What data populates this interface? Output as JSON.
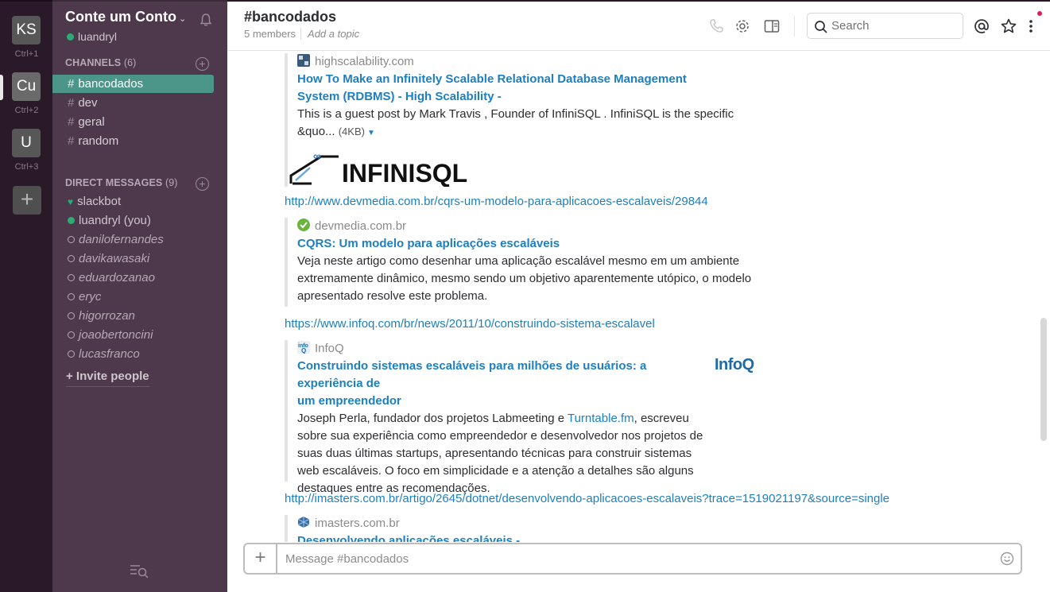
{
  "workspaces": [
    {
      "initials": "KS",
      "shortcut": "Ctrl+1"
    },
    {
      "initials": "Cu",
      "shortcut": "Ctrl+2"
    },
    {
      "initials": "U",
      "shortcut": "Ctrl+3"
    }
  ],
  "add_workspace": "+",
  "team": {
    "name": "Conte um Conto",
    "user": "luandryl"
  },
  "channels": {
    "label": "CHANNELS",
    "count": "(6)",
    "items": [
      "bancodados",
      "dev",
      "geral",
      "random"
    ]
  },
  "direct_messages": {
    "label": "DIRECT MESSAGES",
    "count": "(9)",
    "items": [
      "slackbot",
      "luandryl (you)",
      "danilofernandes",
      "davikawasaki",
      "eduardozanao",
      "eryc",
      "higorrozan",
      "joaobertoncini",
      "lucasfranco"
    ]
  },
  "invite_label": "+ Invite people",
  "header": {
    "title": "#bancodados",
    "members": "5 members",
    "topic": "Add a topic",
    "search_placeholder": "Search"
  },
  "messages": {
    "att1": {
      "source": "highscalability.com",
      "title_line1": "How To Make an Infinitely Scalable Relational Database Management",
      "title_line2": "System (RDBMS) - High Scalability -",
      "text_line1": "This is a guest post by Mark Travis , Founder of InfiniSQL . InfiniSQL is the specific",
      "text_line2": "&quo...",
      "size": "(4KB)",
      "logo_text": "INFINISQL"
    },
    "link2": "http://www.devmedia.com.br/cqrs-um-modelo-para-aplicacoes-escalaveis/29844",
    "att2": {
      "source": "devmedia.com.br",
      "title": "CQRS: Um modelo para aplicações escaláveis",
      "text_line1": "Veja neste artigo como desenhar uma aplicação escalável mesmo em um ambiente",
      "text_line2": "extremamente dinâmico, mesmo sendo um objetivo aparentemente utópico, o modelo",
      "text_line3": "apresentado resolve este problema."
    },
    "link3": "https://www.infoq.com/br/news/2011/10/construindo-sistema-escalavel",
    "att3": {
      "source": "InfoQ",
      "title_line1": "Construindo sistemas escaláveis para milhões de usuários: a experiência de",
      "title_line2": "um empreendedor",
      "text_line1_pre": "Joseph Perla, fundador dos projetos Labmeeting e ",
      "text_line1_link": "Turntable.fm",
      "text_line1_post": ", escreveu",
      "text_line2": "sobre sua experiência como empreendedor e desenvolvedor nos projetos de",
      "text_line3": "suas duas últimas startups, apresentando técnicas para construir sistemas",
      "text_line4": "web escaláveis. O foco em simplicidade e a atenção a detalhes são alguns",
      "text_line5": "destaques entre as recomendações.",
      "logo_text": "InfoQ"
    },
    "link4": "http://imasters.com.br/artigo/2645/dotnet/desenvolvendo-aplicacoes-escalaveis?trace=1519021197&source=single",
    "att4": {
      "source": "imasters.com.br",
      "title": "Desenvolvendo aplicações escaláveis -"
    }
  },
  "composer": {
    "placeholder": "Message #bancodados",
    "plus": "+"
  },
  "colors": {
    "sidebar_bg": "#4d394b",
    "workspace_bg": "#2a1a29",
    "active_channel": "#4c9689",
    "link": "#1d7fbf",
    "presence_online": "#2bac76"
  }
}
